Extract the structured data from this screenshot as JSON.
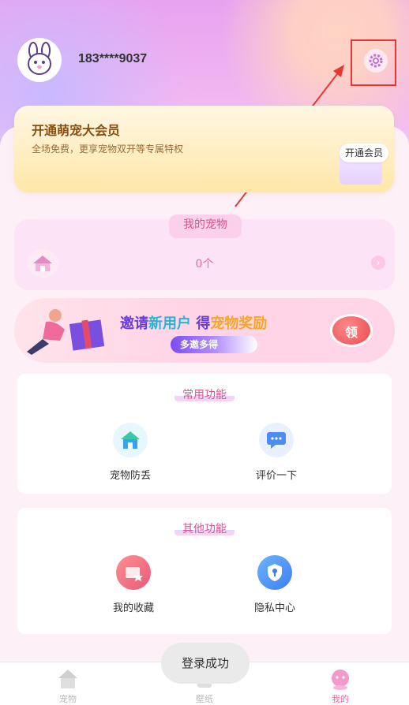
{
  "user": {
    "phone": "183****9037"
  },
  "vip": {
    "title": "开通萌宠大会员",
    "subtitle": "全场免费，更享宠物双开等专属特权",
    "button_label": "开通会员"
  },
  "pets": {
    "tab_label": "我的宠物",
    "count_text": "0个"
  },
  "banner": {
    "title_prefix": "邀请",
    "title_hl": "新用户",
    "title_mid": " 得",
    "title_hl2": "宠物奖励",
    "tag": "多邀多得",
    "button_label": "领"
  },
  "common": {
    "title": "常用功能",
    "items": [
      {
        "label": "宠物防丢",
        "icon": "home-icon"
      },
      {
        "label": "评价一下",
        "icon": "chat-icon"
      }
    ]
  },
  "other": {
    "title": "其他功能",
    "items": [
      {
        "label": "我的收藏",
        "icon": "favorites-icon"
      },
      {
        "label": "隐私中心",
        "icon": "shield-icon"
      }
    ]
  },
  "tabbar": {
    "items": [
      {
        "label": "宠物",
        "active": false
      },
      {
        "label": "壁纸",
        "active": false
      },
      {
        "label": "我的",
        "active": true
      }
    ]
  },
  "toast": {
    "text": "登录成功"
  },
  "colors": {
    "accent": "#e86aa4",
    "annotation": "#e53935",
    "vip_text": "#8a4f10"
  }
}
